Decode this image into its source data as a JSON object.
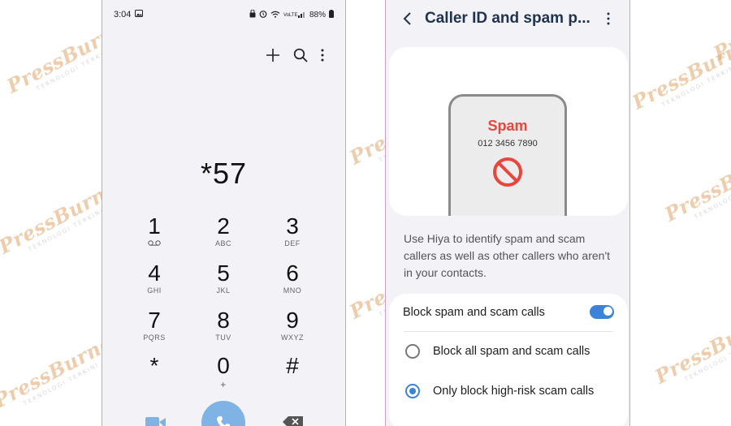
{
  "watermark": {
    "brand": "PressBurner",
    "tagline": "TEKNOLOGI TERKINI"
  },
  "dialer": {
    "status": {
      "time": "3:04",
      "battery": "88%",
      "network": "VoLTE"
    },
    "dialed_number": "*57",
    "keys": [
      {
        "digit": "1",
        "letters": "QO"
      },
      {
        "digit": "2",
        "letters": "ABC"
      },
      {
        "digit": "3",
        "letters": "DEF"
      },
      {
        "digit": "4",
        "letters": "GHI"
      },
      {
        "digit": "5",
        "letters": "JKL"
      },
      {
        "digit": "6",
        "letters": "MNO"
      },
      {
        "digit": "7",
        "letters": "PQRS"
      },
      {
        "digit": "8",
        "letters": "TUV"
      },
      {
        "digit": "9",
        "letters": "WXYZ"
      },
      {
        "digit": "*",
        "letters": ""
      },
      {
        "digit": "0",
        "letters": "+"
      },
      {
        "digit": "#",
        "letters": ""
      }
    ]
  },
  "caller_id": {
    "title": "Caller ID and spam p...",
    "illustration": {
      "label": "Spam",
      "number": "012 3456 7890"
    },
    "description": "Use Hiya to identify spam and scam callers as well as other callers who aren't in your contacts.",
    "block_toggle": {
      "label": "Block spam and scam calls",
      "on": true
    },
    "options": [
      {
        "label": "Block all spam and scam calls",
        "selected": false
      },
      {
        "label": "Only block high-risk scam calls",
        "selected": true
      }
    ]
  },
  "colors": {
    "accent": "#3b82d9",
    "spam": "#e8453c",
    "call": "#7fb3e6",
    "title": "#1f3350"
  }
}
